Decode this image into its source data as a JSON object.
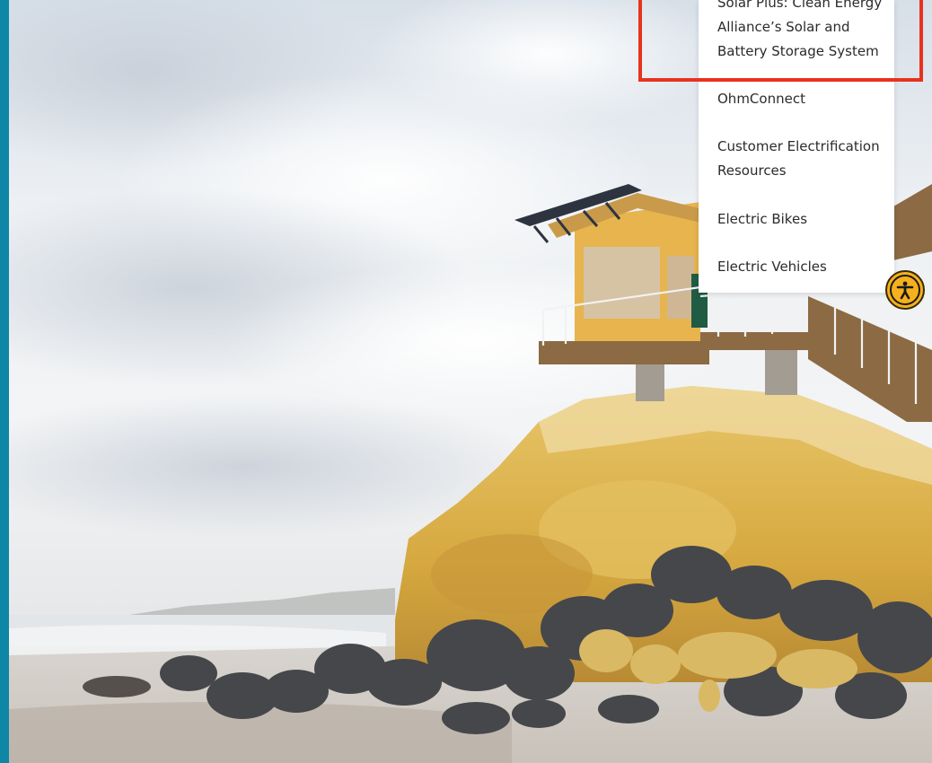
{
  "dropdown": {
    "items": [
      {
        "label": "Solar Plus: Clean Energy Alliance’s Solar and Battery Storage System",
        "highlighted": true
      },
      {
        "label": "OhmConnect"
      },
      {
        "label": "Customer Electrification Resources"
      },
      {
        "label": "Electric Bikes"
      },
      {
        "label": "Electric Vehicles"
      }
    ]
  },
  "hero": {
    "image_subject": "coastal-lifeguard-tower-on-sandstone-bluff"
  },
  "accessibility": {
    "icon": "accessibility-person-icon"
  },
  "colors": {
    "left_accent": "#0e86a6",
    "highlight_border": "#e8321f",
    "a11y_button": "#f6b01e",
    "menu_text": "#2b2b2b"
  }
}
